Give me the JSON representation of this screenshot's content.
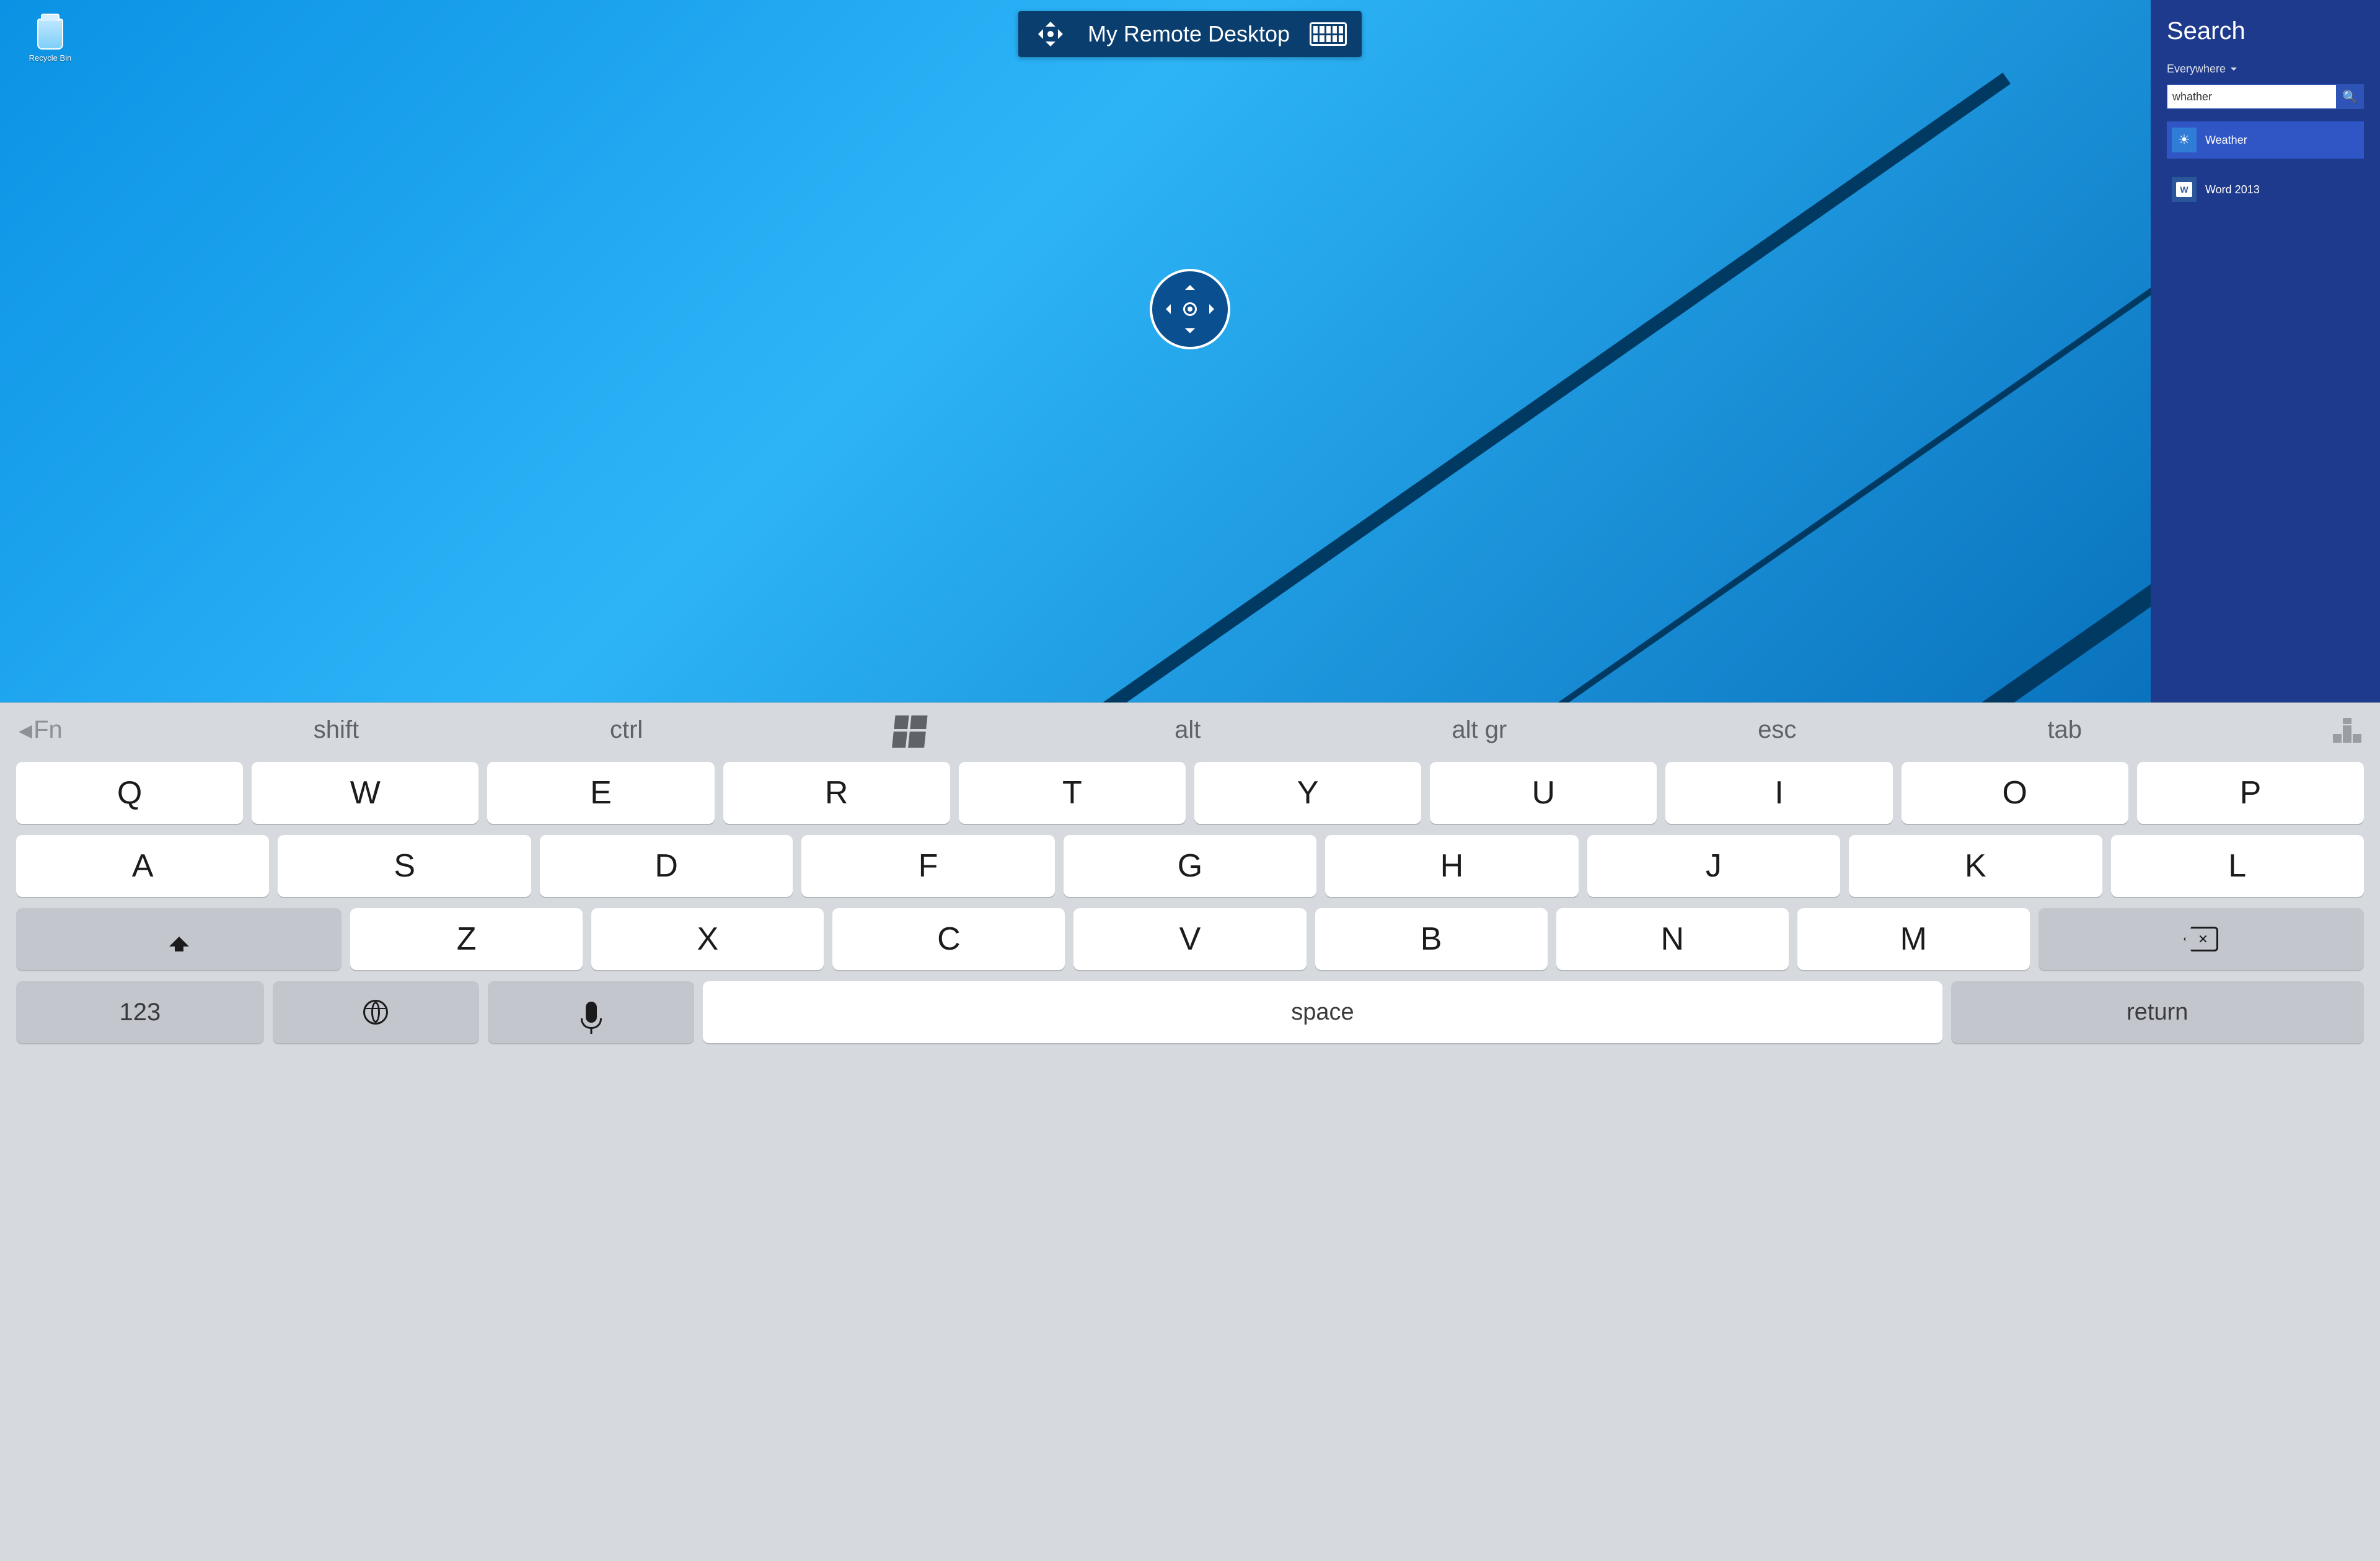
{
  "toolbar": {
    "title": "My Remote Desktop"
  },
  "desktop": {
    "recycle_bin_label": "Recycle Bin"
  },
  "search_charm": {
    "heading": "Search",
    "scope_label": "Everywhere",
    "query": "whather",
    "results": [
      {
        "label": "Weather",
        "icon": "weather",
        "selected": true
      },
      {
        "label": "Word 2013",
        "icon": "word",
        "selected": false
      }
    ]
  },
  "fn_row": {
    "fn": "Fn",
    "shift": "shift",
    "ctrl": "ctrl",
    "alt": "alt",
    "altgr": "alt gr",
    "esc": "esc",
    "tab": "tab"
  },
  "keys": {
    "row1": [
      "Q",
      "W",
      "E",
      "R",
      "T",
      "Y",
      "U",
      "I",
      "O",
      "P"
    ],
    "row2": [
      "A",
      "S",
      "D",
      "F",
      "G",
      "H",
      "J",
      "K",
      "L"
    ],
    "row3": [
      "Z",
      "X",
      "C",
      "V",
      "B",
      "N",
      "M"
    ],
    "num": "123",
    "space": "space",
    "return": "return"
  }
}
